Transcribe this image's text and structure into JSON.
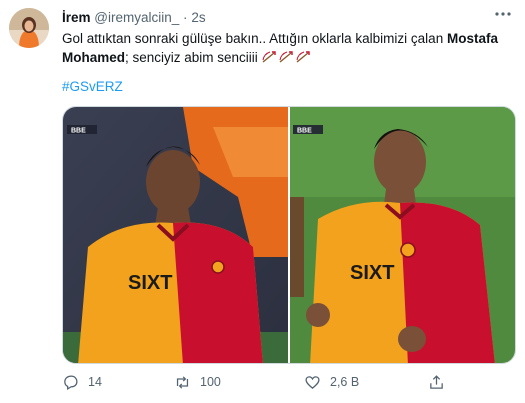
{
  "tweet": {
    "author_name": "İrem",
    "handle": "@iremyalciin_",
    "separator": "·",
    "timestamp": "2s",
    "text_part1": "Gol attıktan sonraki gülüşe bakın.. Attığın oklarla kalbimizi çalan ",
    "text_bold": "Mostafa Mohamed",
    "text_part2": "; senciyiz abim senciiii",
    "hashtag": "#GSvERZ",
    "broadcaster_logo_left": "BBE",
    "broadcaster_logo_right": "BBE",
    "jersey_sponsor_left": "SIXT",
    "jersey_sponsor_right": "SIXT",
    "reply_count": "14",
    "retweet_count": "100",
    "like_count": "2,6 B"
  },
  "colors": {
    "link": "#1d9bf0",
    "secondary_text": "#536471",
    "galatasaray_yellow": "#f2a21c",
    "galatasaray_red": "#c8102e"
  },
  "icons": {
    "more": "more-dots-icon",
    "reply": "reply-icon",
    "retweet": "retweet-icon",
    "like": "heart-icon",
    "share": "share-icon",
    "emoji": "bow-and-arrow-emoji"
  }
}
